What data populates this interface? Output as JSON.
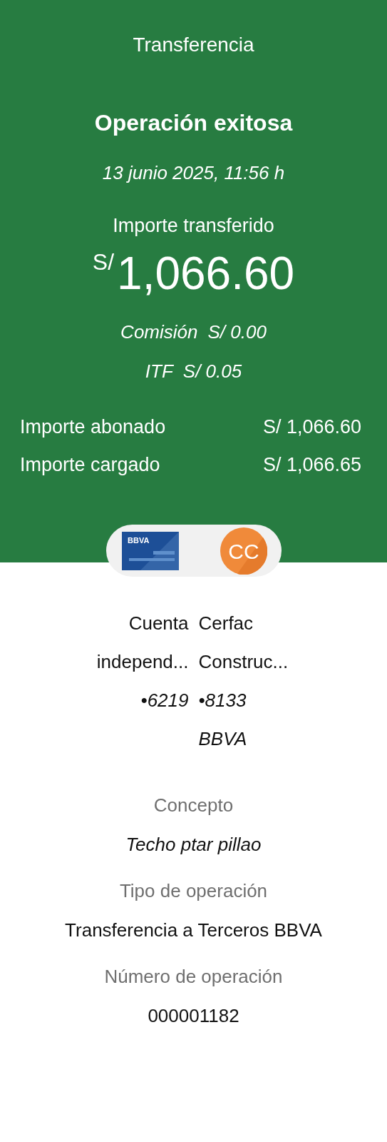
{
  "header": {
    "title": "Transferencia",
    "status": "Operación exitosa",
    "datetime": "13 junio 2025, 11:56 h",
    "amount_label": "Importe transferido",
    "currency": "S/",
    "amount": "1,066.60",
    "fees": [
      {
        "label": "Comisión",
        "value": "S/ 0.00"
      },
      {
        "label": "ITF",
        "value": "S/ 0.05"
      }
    ],
    "totals": [
      {
        "label": "Importe abonado",
        "value": "S/ 1,066.60"
      },
      {
        "label": "Importe cargado",
        "value": "S/ 1,066.65"
      }
    ]
  },
  "parties": {
    "source_logo_text": "BBVA",
    "destination_initials": "CC",
    "source": {
      "name_lines": [
        "Cuenta",
        "independ..."
      ],
      "number": "•6219"
    },
    "destination": {
      "name_lines": [
        "Cerfac",
        "Construc..."
      ],
      "number": "•8133",
      "bank": "BBVA"
    }
  },
  "details": [
    {
      "label": "Concepto",
      "value": "Techo ptar pillao",
      "kind": "italic"
    },
    {
      "label": "Tipo de operación",
      "value": "Transferencia a Terceros BBVA",
      "kind": "plain"
    },
    {
      "label": "Número de operación",
      "value": "000001182",
      "kind": "plain"
    }
  ]
}
